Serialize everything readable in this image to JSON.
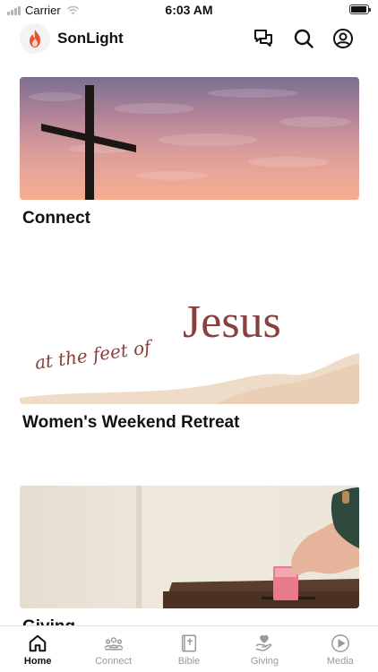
{
  "status_bar": {
    "carrier": "Carrier",
    "time": "6:03 AM",
    "battery_level": 0.95
  },
  "header": {
    "app_name": "SonLight",
    "logo_icon": "flame-icon"
  },
  "header_icons": [
    "chat-icon",
    "search-icon",
    "profile-icon"
  ],
  "feed": [
    {
      "title": "Connect",
      "image": "sunset-sky-with-cross"
    },
    {
      "title": "Women's Weekend Retreat",
      "image_script_text": "at the feet of",
      "image_headline": "Jesus"
    },
    {
      "title": "Giving",
      "image": "hand-placing-money-in-box"
    }
  ],
  "tabs": [
    {
      "label": "Home",
      "icon": "home-icon",
      "active": true
    },
    {
      "label": "Connect",
      "icon": "group-icon",
      "active": false
    },
    {
      "label": "Bible",
      "icon": "bible-icon",
      "active": false
    },
    {
      "label": "Giving",
      "icon": "giving-hand-icon",
      "active": false
    },
    {
      "label": "Media",
      "icon": "play-icon",
      "active": false
    }
  ],
  "colors": {
    "accent": "#111111",
    "inactive": "#9a9a9a",
    "flame": "#e4572e"
  }
}
